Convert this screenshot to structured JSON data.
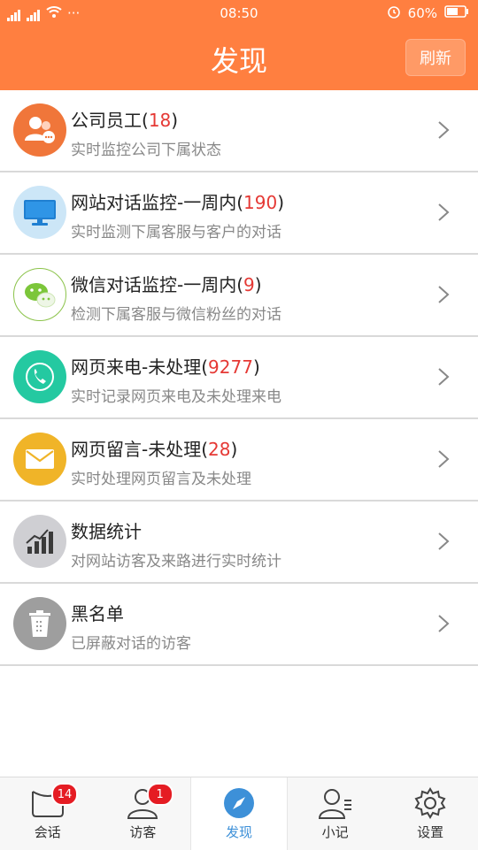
{
  "status": {
    "left": "4G 2G",
    "time": "08:50",
    "battery": "60%"
  },
  "header": {
    "title": "发现",
    "refresh": "刷新"
  },
  "rows": [
    {
      "title": "公司员工(",
      "count": "18",
      "close": ")",
      "subtitle": "实时监控公司下属状态",
      "icon": "staff-icon",
      "color": "#f0763a"
    },
    {
      "title": "网站对话监控-一周内(",
      "count": "190",
      "close": ")",
      "subtitle": "实时监测下属客服与客户的对话",
      "icon": "monitor-icon",
      "color": "#cce6f7"
    },
    {
      "title": "微信对话监控-一周内(",
      "count": "9",
      "close": ")",
      "subtitle": "检测下属客服与微信粉丝的对话",
      "icon": "wechat-icon",
      "color": "#ffffff"
    },
    {
      "title": "网页来电-未处理(",
      "count": "9277",
      "close": ")",
      "subtitle": "实时记录网页来电及未处理来电",
      "icon": "phone-icon",
      "color": "#24c9a1"
    },
    {
      "title": "网页留言-未处理(",
      "count": "28",
      "close": ")",
      "subtitle": "实时处理网页留言及未处理",
      "icon": "mail-icon",
      "color": "#f0b428"
    },
    {
      "title": "数据统计",
      "count": "",
      "close": "",
      "subtitle": "对网站访客及来路进行实时统计",
      "icon": "chart-icon",
      "color": "#cfcfd3"
    },
    {
      "title": "黑名单",
      "count": "",
      "close": "",
      "subtitle": "已屏蔽对话的访客",
      "icon": "trash-icon",
      "color": "#9e9e9e"
    }
  ],
  "tabs": [
    {
      "label": "会话",
      "badge": "14"
    },
    {
      "label": "访客",
      "badge": "1"
    },
    {
      "label": "发现",
      "badge": ""
    },
    {
      "label": "小记",
      "badge": ""
    },
    {
      "label": "设置",
      "badge": ""
    }
  ]
}
